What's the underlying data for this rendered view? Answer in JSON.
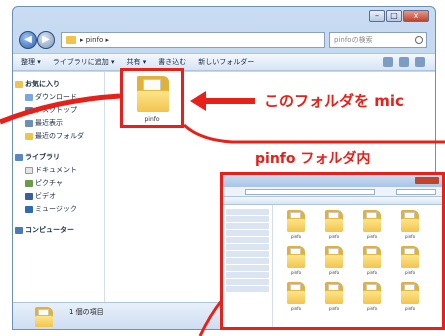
{
  "window": {
    "controls": {
      "min": "–",
      "max": "□",
      "close": "x"
    }
  },
  "address": {
    "path": "▸ pinfo ▸",
    "search_placeholder": "pinfoの検索"
  },
  "toolbar": {
    "items": [
      "整理 ▾",
      "ライブラリに追加 ▾",
      "共有 ▾",
      "書き込む",
      "新しいフォルダー"
    ]
  },
  "navpane": {
    "favorites": "お気に入り",
    "favorite_items": [
      "ダウンロード",
      "デスクトップ",
      "最近表示",
      "最近のフォルダ"
    ],
    "libraries": "ライブラリ",
    "library_items": [
      "ドキュメント",
      "ピクチャ",
      "ビデオ",
      "ミュージック"
    ],
    "computer": "コンピューター"
  },
  "selected_folder": {
    "label": "pinfo"
  },
  "status": {
    "text": "1 個の項目"
  },
  "callouts": {
    "main": "このフォルダを mic",
    "sub": "pinfo フォルダ内"
  },
  "inset": {
    "files": [
      "pinfo",
      "pinfo",
      "pinfo",
      "pinfo",
      "pinfo",
      "pinfo",
      "pinfo",
      "pinfo",
      "pinfo",
      "pinfo",
      "pinfo",
      "pinfo"
    ]
  },
  "colors": {
    "accent_red": "#e8201a",
    "folder_yellow": "#f2c44e",
    "window_blue": "#a9c4e6"
  }
}
